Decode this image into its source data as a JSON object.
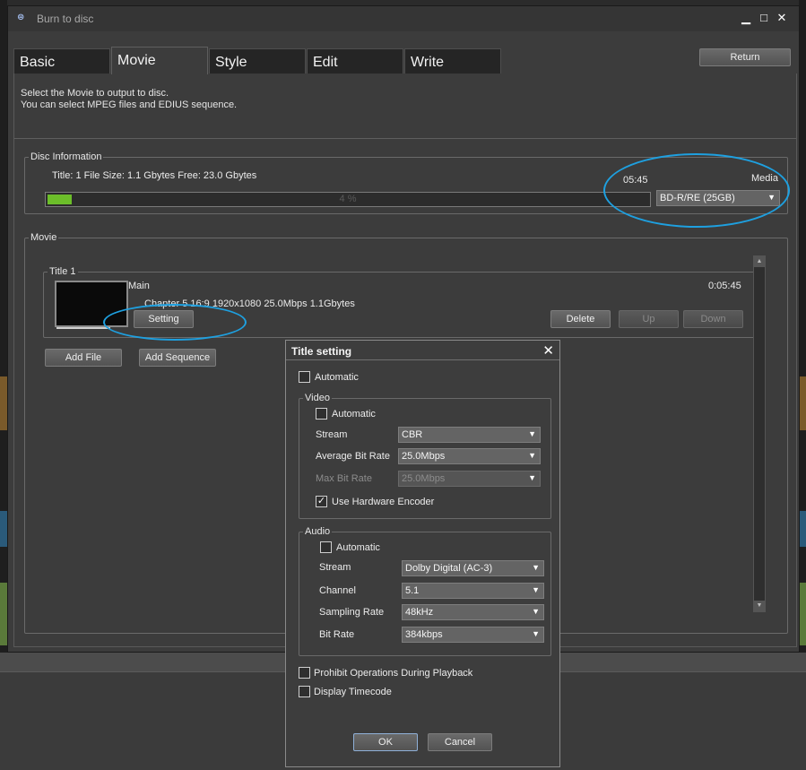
{
  "window": {
    "title": "Burn to disc",
    "app_icon": "disc-burn-icon"
  },
  "tabs": [
    {
      "label": "Basic",
      "active": false
    },
    {
      "label": "Movie",
      "active": true
    },
    {
      "label": "Style",
      "active": false
    },
    {
      "label": "Edit",
      "active": false
    },
    {
      "label": "Write",
      "active": false
    }
  ],
  "return_label": "Return",
  "description": {
    "line1": "Select the Movie to output to disc.",
    "line2": "You can select MPEG files and EDIUS sequence."
  },
  "disc_info": {
    "legend": "Disc Information",
    "summary": "Title: 1   File Size: 1.1 Gbytes   Free: 23.0 Gbytes",
    "time": "05:45",
    "usage_percent": 4,
    "usage_text": "4 %",
    "media_label": "Media",
    "media_value": "BD-R/RE (25GB)"
  },
  "movie": {
    "legend": "Movie",
    "title_legend": "Title 1",
    "clip_name": "Main",
    "clip_info": "Chapter 5   16:9   1920x1080   25.0Mbps   1.1Gbytes",
    "duration": "0:05:45",
    "setting_label": "Setting",
    "delete_label": "Delete",
    "up_label": "Up",
    "down_label": "Down",
    "add_file_label": "Add File",
    "add_sequence_label": "Add Sequence"
  },
  "dialog": {
    "title": "Title setting",
    "automatic": "Automatic",
    "video": {
      "legend": "Video",
      "automatic": "Automatic",
      "stream_label": "Stream",
      "stream_value": "CBR",
      "avg_label": "Average Bit Rate",
      "avg_value": "25.0Mbps",
      "max_label": "Max Bit Rate",
      "max_value": "25.0Mbps",
      "hw_label": "Use Hardware Encoder",
      "hw_checked": true
    },
    "audio": {
      "legend": "Audio",
      "automatic": "Automatic",
      "stream_label": "Stream",
      "stream_value": "Dolby Digital (AC-3)",
      "channel_label": "Channel",
      "channel_value": "5.1",
      "sampling_label": "Sampling Rate",
      "sampling_value": "48kHz",
      "bitrate_label": "Bit Rate",
      "bitrate_value": "384kbps"
    },
    "prohibit_label": "Prohibit Operations During Playback",
    "timecode_label": "Display Timecode",
    "ok_label": "OK",
    "cancel_label": "Cancel"
  }
}
